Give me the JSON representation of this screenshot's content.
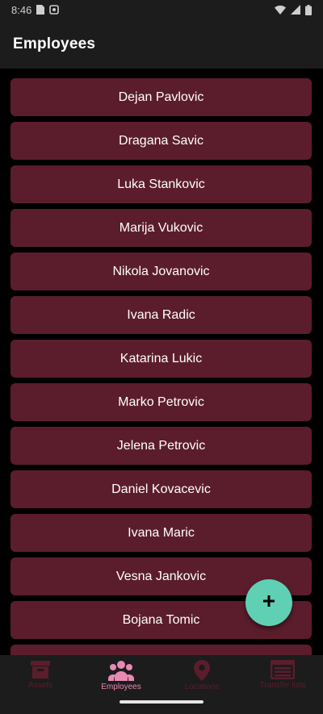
{
  "status_bar": {
    "time": "8:46"
  },
  "header": {
    "title": "Employees"
  },
  "employees": [
    "Dejan Pavlovic",
    "Dragana Savic",
    "Luka Stankovic",
    "Marija Vukovic",
    "Nikola Jovanovic",
    "Ivana Radic",
    "Katarina Lukic",
    "Marko Petrovic",
    "Jelena Petrovic",
    "Daniel Kovacevic",
    "Ivana Maric",
    "Vesna Jankovic",
    "Bojana Tomic"
  ],
  "fab": {
    "icon": "plus-icon",
    "color": "#5fd0b3"
  },
  "bottom_nav": {
    "items": [
      {
        "label": "Assets",
        "icon": "box-icon",
        "active": false
      },
      {
        "label": "Employees",
        "icon": "people-icon",
        "active": true
      },
      {
        "label": "Locations",
        "icon": "map-pin-icon",
        "active": false
      },
      {
        "label": "Transfer lists",
        "icon": "list-icon",
        "active": false
      }
    ]
  },
  "colors": {
    "item_background": "#5b1d2c",
    "active_nav": "#e78ab3",
    "inactive_nav": "#5b1d2c",
    "bar_background": "#1c1c1c",
    "page_background": "#000000"
  }
}
